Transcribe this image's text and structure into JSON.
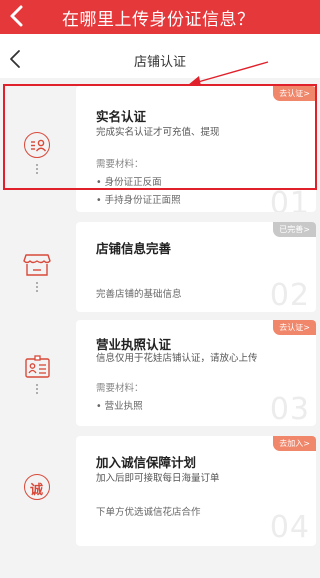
{
  "banner": {
    "title": "在哪里上传身份证信息？"
  },
  "nav": {
    "title": "店铺认证"
  },
  "cards": [
    {
      "title": "实名认证",
      "desc": "完成实名认证才可充值、提现",
      "materials_label": "需要材料：",
      "items": [
        "身份证正反面",
        "手持身份证正面照"
      ],
      "badge": "去认证>",
      "number": "01"
    },
    {
      "title": "店铺信息完善",
      "desc": "完善店铺的基础信息",
      "badge": "已完善>",
      "number": "02"
    },
    {
      "title": "营业执照认证",
      "desc": "信息仅用于花娃店铺认证，请放心上传",
      "materials_label": "需要材料：",
      "items": [
        "营业执照"
      ],
      "badge": "去认证>",
      "number": "03"
    },
    {
      "title": "加入诚信保障计划",
      "desc": "加入后即可接取每日海量订单",
      "desc2": "下单方优选诚信花店合作",
      "badge": "去加入>",
      "number": "04"
    }
  ],
  "icons": {
    "step1": "id-card-person-icon",
    "step2": "store-icon",
    "step3": "license-card-icon",
    "step4": "integrity-icon",
    "step4_glyph": "诚"
  },
  "colors": {
    "banner": "#e5383b",
    "accent": "#d8493a",
    "badge": "#f0866a",
    "badge_done": "#c8c8c8",
    "highlight": "#e0202a"
  }
}
